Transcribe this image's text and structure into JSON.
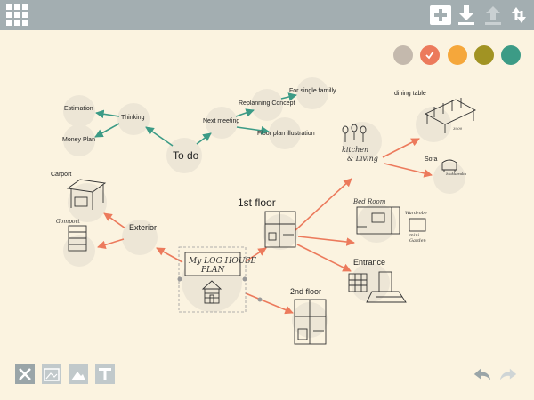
{
  "toolbar": {
    "menu_icon": "grid-icon",
    "actions": [
      "add-node-icon",
      "download-icon",
      "upload-icon",
      "sync-icon"
    ]
  },
  "palette": {
    "colors": [
      "#c4b9ad",
      "#ec7a5c",
      "#f5a73b",
      "#a19323",
      "#3c9b86"
    ],
    "selected_index": 1
  },
  "nodes": {
    "root": {
      "handwritten_title_line1": "My LOG HOUSE",
      "handwritten_title_line2": "PLAN"
    },
    "todo": "To do",
    "thinking": "Thinking",
    "estimation": "Estimation",
    "money_plan": "Money Plan",
    "next_meeting": "Next meeting",
    "replanning": "Replanning Concept",
    "for_single": "For single familly",
    "floor_plan": "Floor plan illustration",
    "exterior": "Exterior",
    "carport": "Carport",
    "garage_sketch": "Gomport",
    "first_floor": "1st floor",
    "second_floor": "2nd floor",
    "kitchen_line1": "kitchen",
    "kitchen_line2": "& Living",
    "dining_table": "dining table",
    "sofa": "Sofa",
    "bedroom": "Bed Room",
    "bedroom_notes_1": "Wardrobe",
    "bedroom_notes_2": "mini",
    "bedroom_notes_3": "Garden",
    "entrance": "Entrance",
    "sofa_sketch_label": "Mokkoraba",
    "dining_sketch_label": "3000"
  },
  "bottom_toolbar": {
    "left": [
      "delete-icon",
      "add-image-icon",
      "picture-icon",
      "text-icon"
    ],
    "right": [
      "undo-icon",
      "redo-icon"
    ]
  },
  "colors": {
    "background": "#fbf3e0",
    "topbar": "#a3aeb1",
    "node_circle": "#ede6d6",
    "orange_link": "#ec7a5c",
    "green_link": "#3c9b86"
  }
}
